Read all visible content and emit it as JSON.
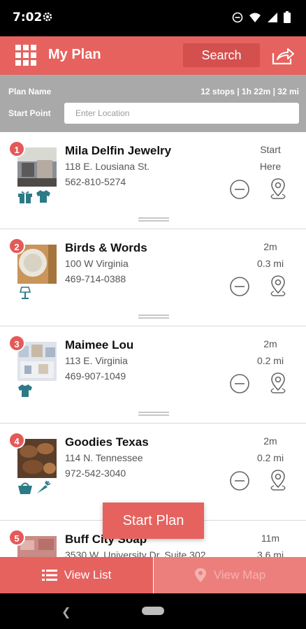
{
  "status_bar": {
    "time": "7:02"
  },
  "app_bar": {
    "title": "My Plan",
    "search_label": "Search"
  },
  "plan_bar": {
    "plan_name_label": "Plan Name",
    "summary": "12 stops | 1h 22m | 32 mi",
    "start_point_label": "Start Point",
    "location_placeholder": "Enter Location"
  },
  "stops": [
    {
      "number": "1",
      "name": "Mila Delfin Jewelry",
      "address": "118 E. Lousiana St.",
      "phone": "562-810-5274",
      "time": "Start",
      "distance": "Here",
      "tags": [
        "gift-icon",
        "shirt-icon"
      ]
    },
    {
      "number": "2",
      "name": "Birds & Words",
      "address": "100 W Virginia",
      "phone": "469-714-0388",
      "time": "2m",
      "distance": "0.3 mi",
      "tags": [
        "lamp-icon"
      ]
    },
    {
      "number": "3",
      "name": "Maimee Lou",
      "address": "113 E. Virginia",
      "phone": "469-907-1049",
      "time": "2m",
      "distance": "0.2 mi",
      "tags": [
        "shirt-icon"
      ]
    },
    {
      "number": "4",
      "name": "Goodies Texas",
      "address": "114 N. Tennessee",
      "phone": "972-542-3040",
      "time": "2m",
      "distance": "0.2 mi",
      "tags": [
        "basket-icon",
        "carrot-icon"
      ]
    },
    {
      "number": "5",
      "name": "Buff City Soap",
      "address": "3530 W. University Dr. Suite 302",
      "phone": "",
      "time": "11m",
      "distance": "3.6 mi",
      "tags": []
    }
  ],
  "start_plan_label": "Start Plan",
  "bottom_tabs": {
    "view_list": "View List",
    "view_map": "View Map"
  },
  "colors": {
    "primary": "#e6625f",
    "badge": "#e35a58",
    "tag": "#2c7a86",
    "plan_bar": "#a9a9a9"
  }
}
